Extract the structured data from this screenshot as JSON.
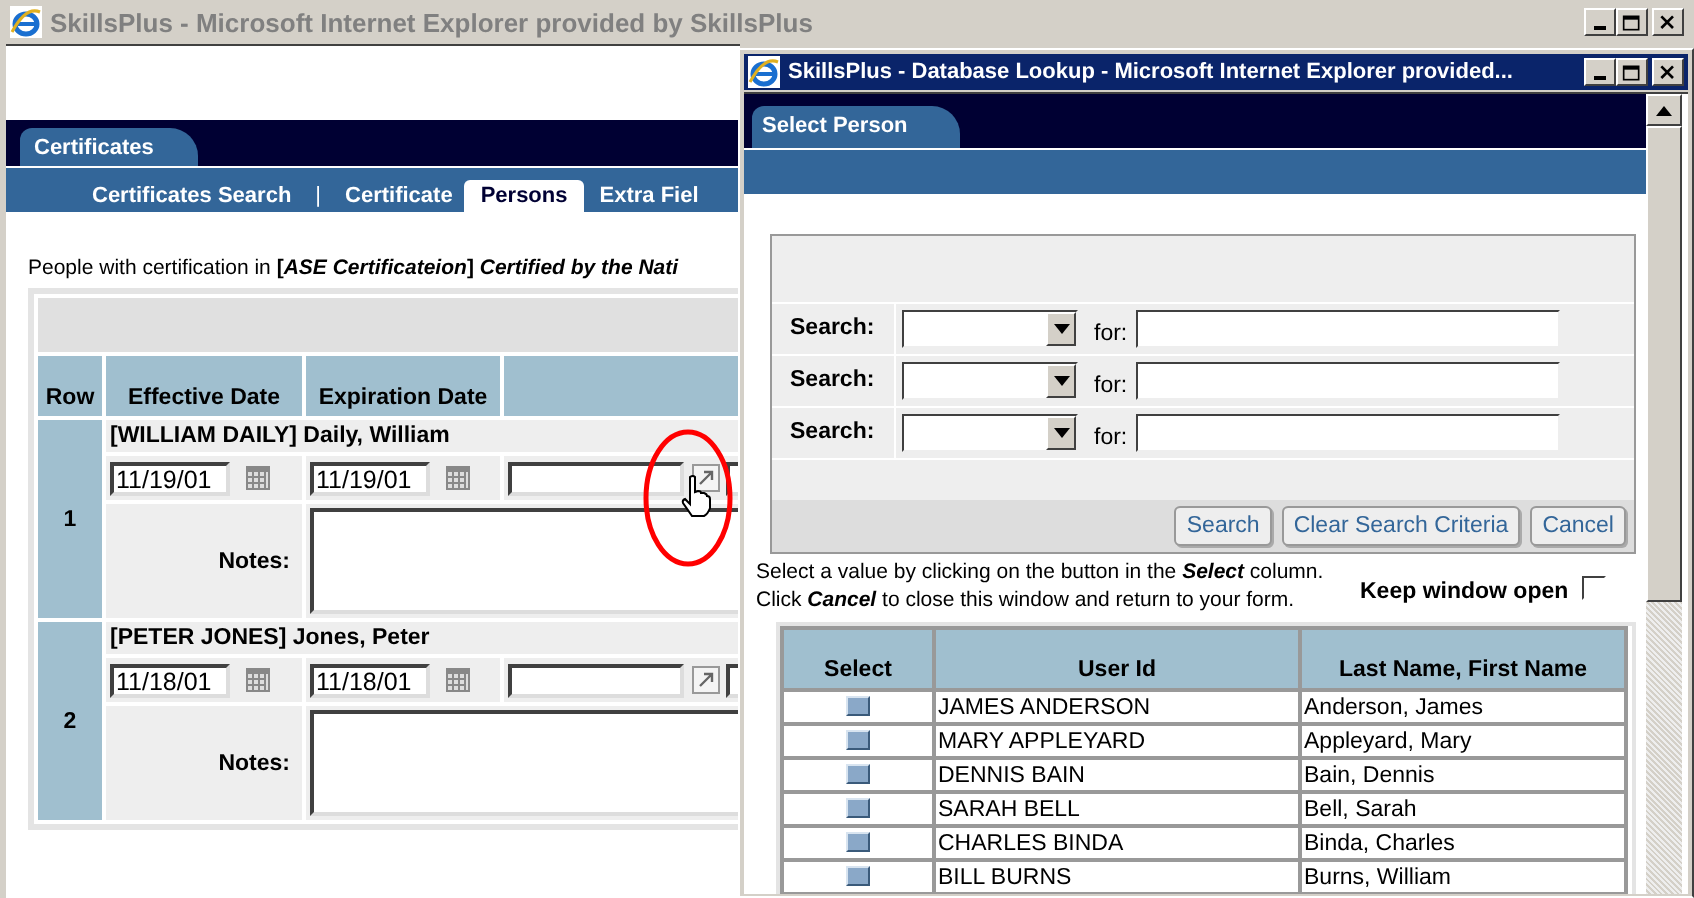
{
  "main_window": {
    "title": "SkillsPlus - Microsoft Internet Explorer provided by SkillsPlus",
    "section_tab": "Certificates",
    "subtabs": [
      {
        "label": "Certificates Search",
        "selected": false
      },
      {
        "label": "|",
        "kind": "separator"
      },
      {
        "label": "Certificate",
        "selected": false
      },
      {
        "label": "Persons",
        "selected": true
      },
      {
        "label": "Extra Fiel",
        "selected": false
      }
    ],
    "intro": "People with certification in **[*ASE Certificateion*]** *Certified by the Nati*",
    "table": {
      "columns": [
        "Row",
        "Effective Date",
        "Expiration Date"
      ],
      "rows": [
        {
          "row": "1",
          "person": "[WILLIAM DAILY] Daily, William",
          "effective": "11/19/01",
          "expiration": "11/19/01",
          "notes_label": "Notes:",
          "highlighted": true
        },
        {
          "row": "2",
          "person": "[PETER JONES] Jones, Peter",
          "effective": "11/18/01",
          "expiration": "11/18/01",
          "notes_label": "Notes:",
          "highlighted": false
        }
      ]
    }
  },
  "popup_window": {
    "title": "SkillsPlus - Database Lookup - Microsoft Internet Explorer provided...",
    "tab": "Select Person",
    "search_rows": [
      {
        "label": "Search:",
        "for_label": "for:"
      },
      {
        "label": "Search:",
        "for_label": "for:"
      },
      {
        "label": "Search:",
        "for_label": "for:"
      }
    ],
    "buttons": [
      "Search",
      "Clear Search Criteria",
      "Cancel"
    ],
    "instructions": "Select a value by clicking on the button in the *Select* column.\nClick *Cancel* to close this window and return to your form.",
    "keep_open": {
      "label": "Keep window open",
      "checked": false
    },
    "results": {
      "columns": [
        "Select",
        "User Id",
        "Last Name, First Name"
      ],
      "rows": [
        {
          "user_id": "JAMES ANDERSON",
          "name": "Anderson, James"
        },
        {
          "user_id": "MARY APPLEYARD",
          "name": "Appleyard, Mary"
        },
        {
          "user_id": "DENNIS BAIN",
          "name": "Bain, Dennis"
        },
        {
          "user_id": "SARAH BELL",
          "name": "Bell, Sarah"
        },
        {
          "user_id": "CHARLES BINDA",
          "name": "Binda, Charles"
        },
        {
          "user_id": "BILL BURNS",
          "name": "Burns, William"
        }
      ]
    }
  }
}
